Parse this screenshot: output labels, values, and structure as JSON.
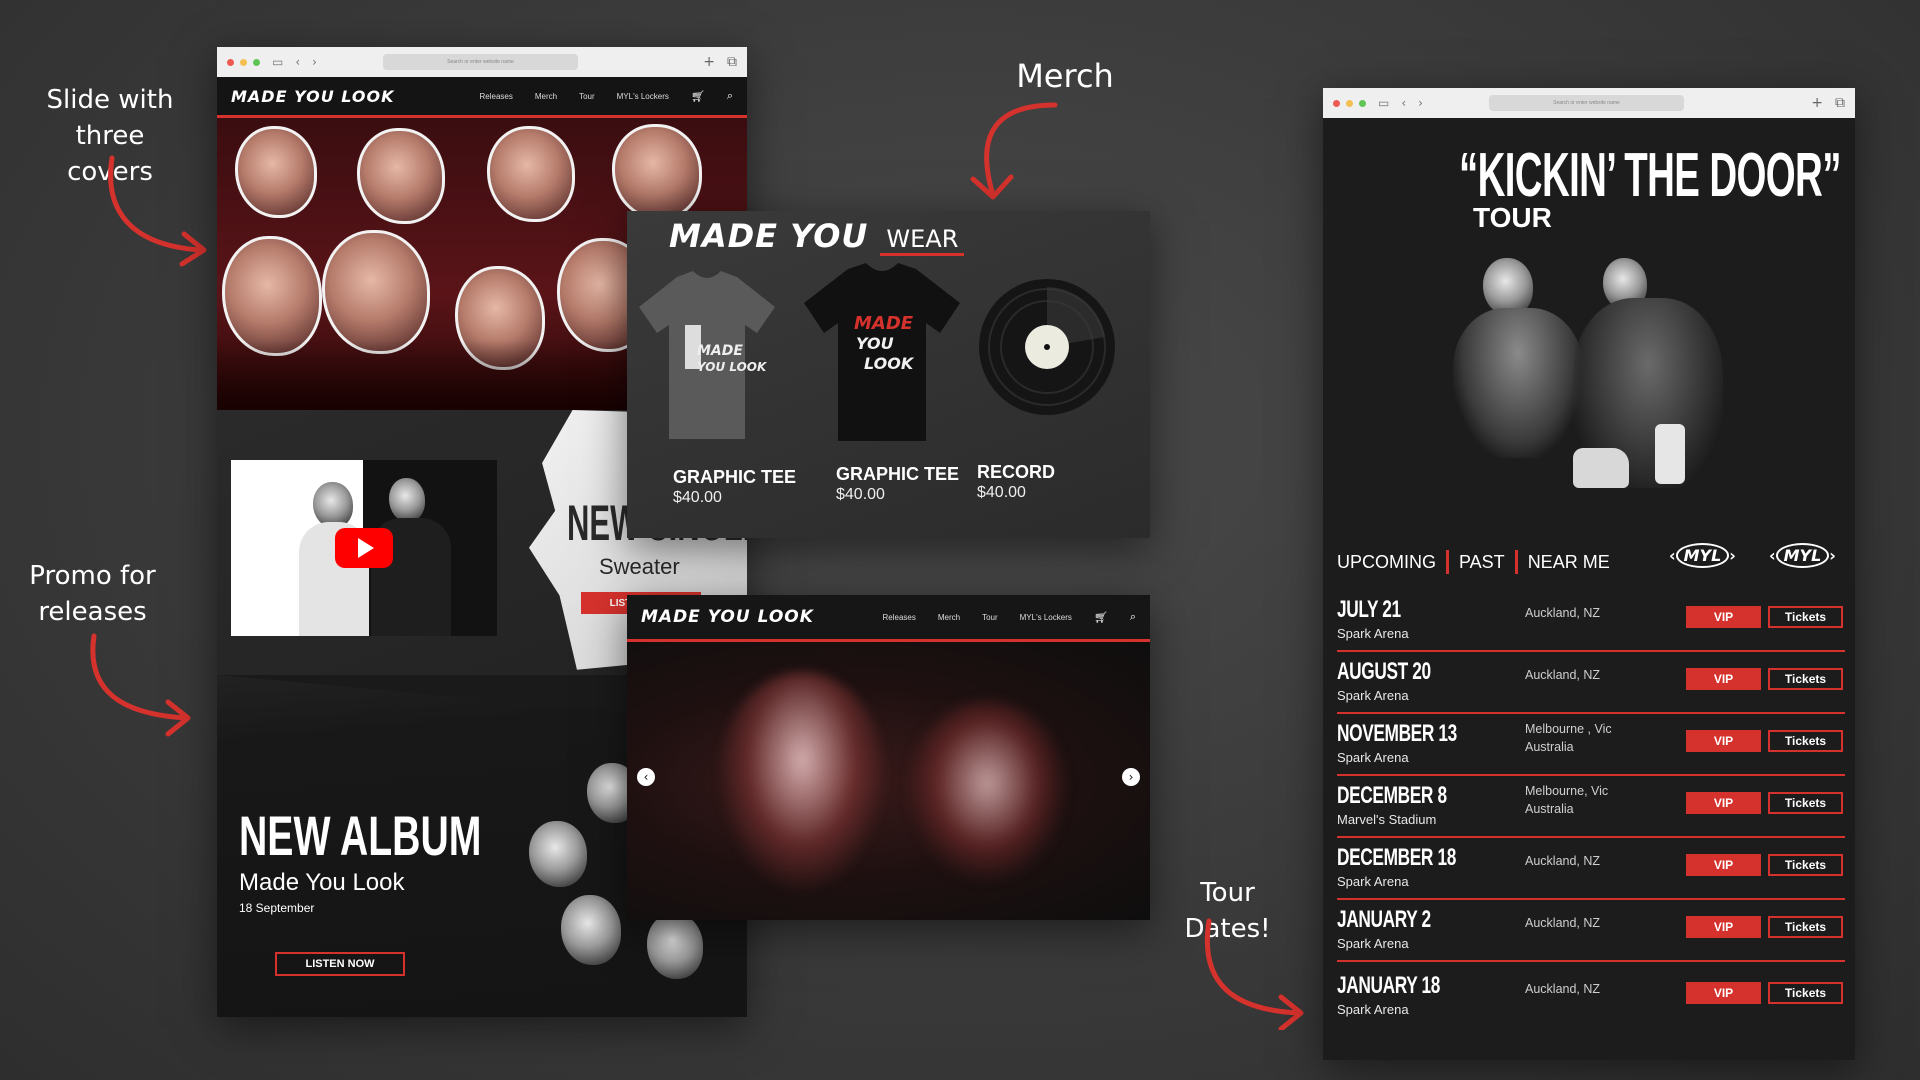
{
  "annotations": {
    "slide": [
      "Slide with",
      "three covers"
    ],
    "merch": "Merch",
    "promo": [
      "Promo for",
      "releases"
    ],
    "tour": "Tour Dates!"
  },
  "colors": {
    "accent": "#d6322d",
    "background": "#3a3a3a",
    "panel": "#1a1a1a"
  },
  "browser": {
    "url_placeholder": "Search or enter website name"
  },
  "site": {
    "logo": "MADE YOU LOOK",
    "nav": [
      "Releases",
      "Merch",
      "Tour",
      "MYL's Lockers"
    ]
  },
  "single_promo": {
    "title": "NEW SINGLE",
    "subtitle": "Sweater",
    "button": "LISTEN NOW"
  },
  "album_promo": {
    "title": "NEW ALBUM",
    "subtitle": "Made You Look",
    "date": "18 September",
    "button": "LISTEN NOW"
  },
  "merch": {
    "logo_main": "MADE YOU",
    "logo_accent": "WEAR",
    "items": [
      {
        "name": "GRAPHIC TEE",
        "price": "$40.00"
      },
      {
        "name": "GRAPHIC TEE",
        "price": "$40.00"
      },
      {
        "name": "RECORD",
        "price": "$40.00"
      }
    ]
  },
  "tour": {
    "title": "“KICKIN’ THE DOOR”",
    "subtitle": "TOUR",
    "tabs": [
      "UPCOMING",
      "PAST",
      "NEAR ME"
    ],
    "badge": "MYL",
    "vip_label": "VIP",
    "tickets_label": "Tickets",
    "dates": [
      {
        "date": "JULY 21",
        "venue": "Spark Arena",
        "location": "Auckland, NZ"
      },
      {
        "date": "AUGUST 20",
        "venue": "Spark Arena",
        "location": "Auckland, NZ"
      },
      {
        "date": "NOVEMBER 13",
        "venue": "Spark Arena",
        "location": "Melbourne , Vic Australia"
      },
      {
        "date": "DECEMBER 8",
        "venue": "Marvel's Stadium",
        "location": "Melbourne, Vic Australia"
      },
      {
        "date": "DECEMBER 18",
        "venue": "Spark Arena",
        "location": "Auckland, NZ"
      },
      {
        "date": "JANUARY 2",
        "venue": "Spark Arena",
        "location": "Auckland, NZ"
      },
      {
        "date": "JANUARY 18",
        "venue": "Spark Arena",
        "location": "Auckland, NZ"
      }
    ]
  },
  "icons": {
    "cart": "cart-icon",
    "search": "search-icon",
    "play": "youtube-play-icon",
    "prev": "chevron-left-icon",
    "next": "chevron-right-icon"
  }
}
